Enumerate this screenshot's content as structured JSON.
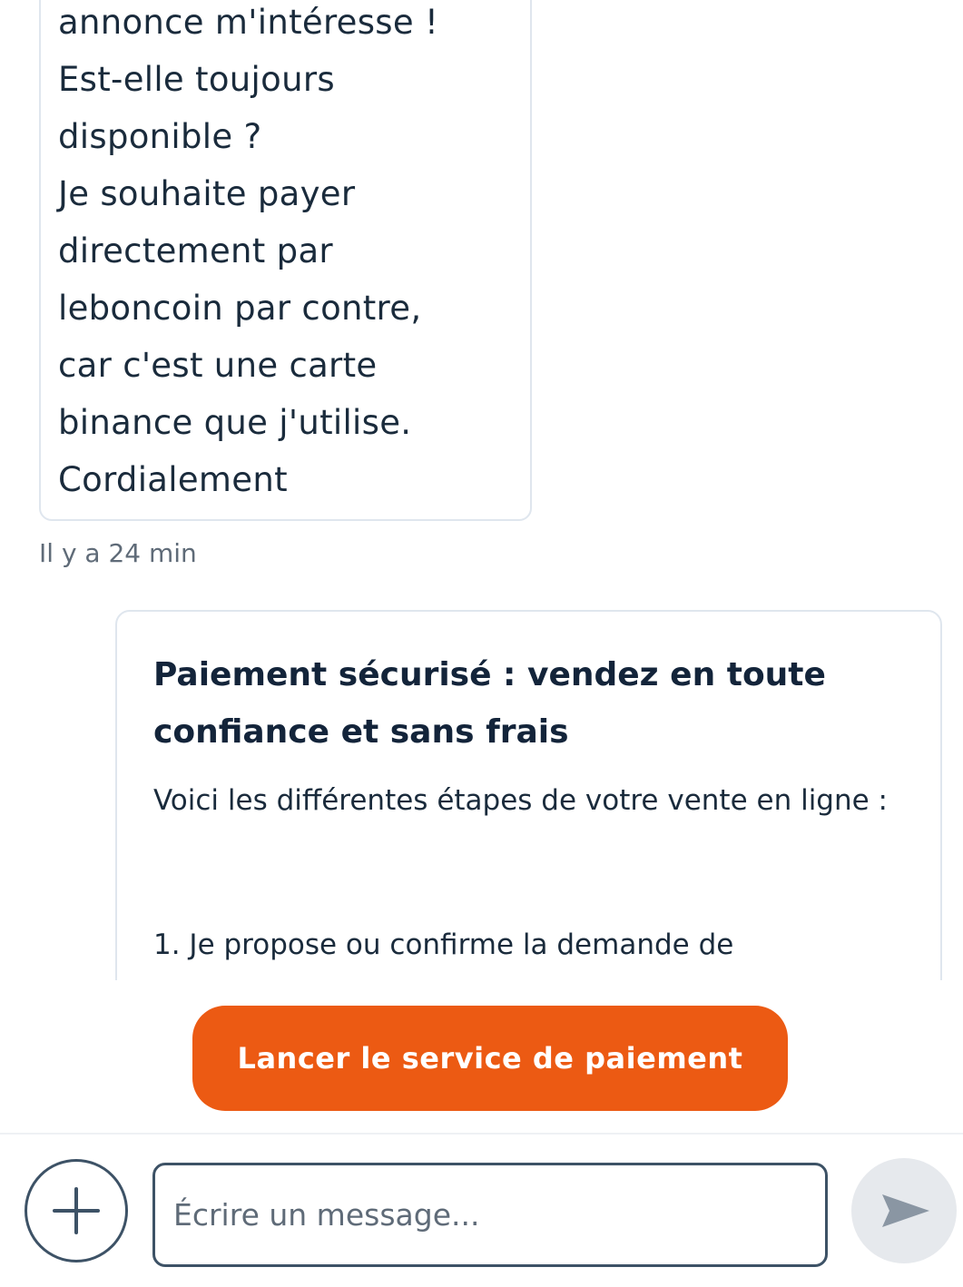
{
  "conversation": {
    "incoming_message": {
      "lines": [
        "annonce m'intéresse !",
        "Est-elle toujours",
        "disponible ?",
        "Je souhaite payer",
        "directement par",
        "leboncoin par contre,",
        "car c'est une carte",
        "binance que j'utilise.",
        "Cordialement"
      ],
      "timestamp": "Il y a 24 min"
    },
    "payment_card": {
      "title": "Paiement sécurisé : vendez en toute confiance et sans frais",
      "intro": "Voici les différentes étapes de votre vente en ligne :",
      "step_1": "1. Je propose ou confirme la demande de"
    }
  },
  "actions": {
    "launch_payment_label": "Lancer le service de paiement",
    "accent_color": "#ec5a13"
  },
  "composer": {
    "add_icon": "plus-icon",
    "input_placeholder": "Écrire un message...",
    "input_value": "",
    "send_icon": "send-icon"
  }
}
